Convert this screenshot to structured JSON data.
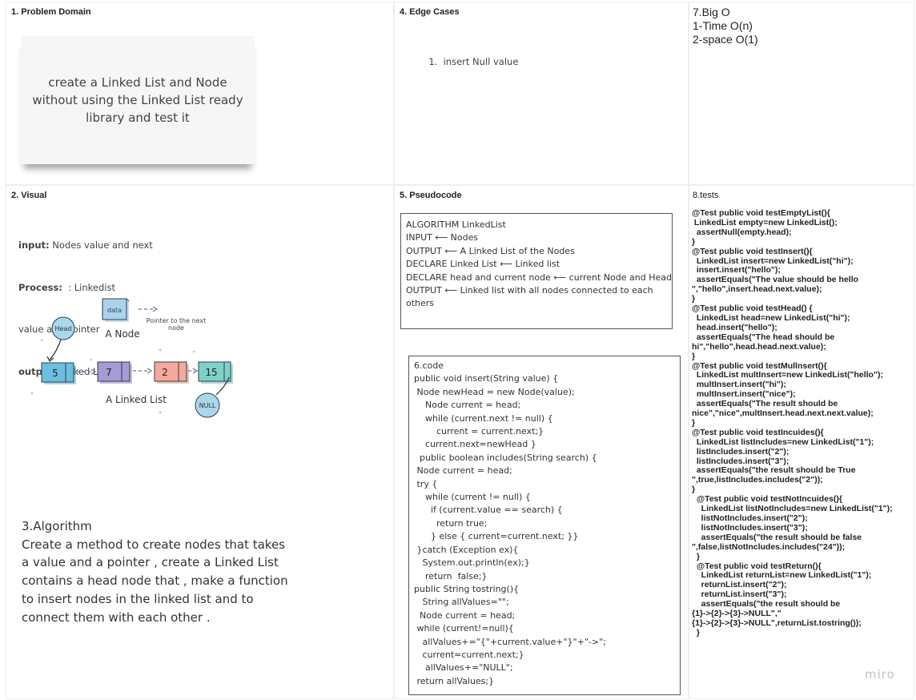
{
  "frames": {
    "problem_domain": "1. Problem Domain",
    "edge_cases": "4. Edge Cases",
    "visual": "2. Visual",
    "pseudocode": "5. Pseudocode",
    "tests": "8.tests"
  },
  "problem_sticky": "create a Linked List and Node without using the Linked List ready library and test it",
  "edge_case_item": "insert Null value",
  "big_o": [
    "7.Big O",
    "1-Time O(n)",
    "2-space O(1)"
  ],
  "visual": {
    "input_label": "input:",
    "input_text": " Nodes value and next",
    "process_label": "Process:",
    "process_text": "  : Linkedist",
    "value_pointer": "value and pointer",
    "output_label": "output:",
    "output_text": " Linked List",
    "diagram": {
      "data_label": "data",
      "pointer_text_1": "Pointer to the next",
      "pointer_text_2": "node",
      "a_node": "A Node",
      "head": "Head",
      "nodes": [
        "5",
        "7",
        "2",
        "15"
      ],
      "null_label": "NULL",
      "a_linked_list": "A Linked List"
    }
  },
  "algorithm": {
    "title": "3.Algorithm",
    "body": "Create a method to create nodes that takes a value  and a pointer , create a Linked List contains a head node that , make a function to insert nodes in the linked list and to connect them with each other ."
  },
  "pseudocode_lines": [
    "ALGORITHM LinkedList",
    "INPUT ⟵ Nodes",
    "OUTPUT ⟵ A Linked List of the Nodes",
    "DECLARE Linked List ⟵ Linked list",
    "DECLARE head and current node ⟵ current Node and Head",
    "OUTPUT ⟵ Linked list with all nodes connected to each",
    "others"
  ],
  "code_lines": [
    "6.code",
    "public void insert(String value) {",
    " Node newHead = new Node(value);",
    "    Node current = head;",
    "    while (current.next != null) {",
    "        current = current.next;}",
    "    current.next=newHead }",
    "  public boolean includes(String search) {",
    " Node current = head;",
    " try {",
    "    while (current != null) {",
    "      if (current.value == search) {",
    "        return true;",
    "      } else { current=current.next; }}",
    " }catch (Exception ex){",
    "   System.out.println(ex);}",
    "    return  false;}",
    "public String tostring(){",
    "   String allValues=\"\";",
    "  Node current = head;",
    " while (current!=null){",
    "   allValues+=\"{\"+current.value+\"}\"+\"->\";",
    "   current=current.next;}",
    "    allValues+=\"NULL\";",
    " return allValues;}"
  ],
  "tests_lines": [
    "@Test public void testEmptyList(){",
    " LinkedList empty=new LinkedList();",
    "  assertNull(empty.head);",
    "}",
    "@Test public void testInsert(){",
    "  LinkedList insert=new LinkedList(\"hi\");",
    "  insert.insert(\"hello\");",
    "  assertEquals(\"The value should be hello",
    "\",\"hello\",insert.head.next.value);",
    "}",
    "@Test public void testHead() {",
    "  LinkedList head=new LinkedList(\"hi\");",
    "  head.insert(\"hello\");",
    "  assertEquals(\"The head should be",
    "hi\",\"hello\",head.head.next.value);",
    "}",
    "@Test public void testMullnsert(){",
    "  LinkedList multInsert=new LinkedList(\"hello\");",
    "  multInsert.insert(\"hi\");",
    "  multInsert.insert(\"nice\");",
    "  assertEquals(\"The result should be",
    "nice\",\"nice\",multInsert.head.next.next.value);",
    "}",
    "@Test public void testIncuides(){",
    "  LinkedList listIncludes=new LinkedList(\"1\");",
    "  listIncludes.insert(\"2\");",
    "  listIncludes.insert(\"3\");",
    "  assertEquals(\"the result should be True",
    "\",true,listIncludes.includes(\"2\"));",
    "}",
    "  @Test public void testNotIncuides(){",
    "    LinkedList listNotIncludes=new LinkedList(\"1\");",
    "    listNotIncludes.insert(\"2\");",
    "    listNotIncludes.insert(\"3\");",
    "    assertEquals(\"the result should be false",
    "\",false,listNotIncludes.includes(\"24\"));",
    "  }",
    "  @Test public void testReturn(){",
    "    LinkedList returnList=new LinkedList(\"1\");",
    "    returnList.insert(\"2\");",
    "    returnList.insert(\"3\");",
    "    assertEquals(\"the result should be",
    "{1}->{2}->{3}->NULL\",\"",
    "{1}->{2}->{3}->NULL\",returnList.tostring());",
    "  }"
  ],
  "watermark": "miro",
  "colors": {
    "node_blue": "#6cbfe0",
    "node_purple": "#a69bd4",
    "node_salmon": "#f4a99c",
    "node_teal": "#7fd1c7",
    "head_blue": "#a9d7ec"
  }
}
